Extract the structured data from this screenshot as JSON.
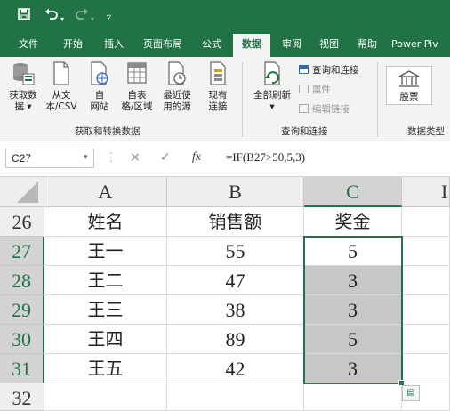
{
  "title_bar": {
    "save_icon": "save-icon",
    "undo_icon": "undo-icon",
    "redo_icon": "redo-icon",
    "customize_icon": "chevron-down-icon"
  },
  "ribbon_tabs": [
    {
      "label": "文件"
    },
    {
      "label": "开始"
    },
    {
      "label": "插入"
    },
    {
      "label": "页面布局"
    },
    {
      "label": "公式"
    },
    {
      "label": "数据"
    },
    {
      "label": "审阅"
    },
    {
      "label": "视图"
    },
    {
      "label": "帮助"
    },
    {
      "label": "Power Piv"
    }
  ],
  "ribbon": {
    "get_transform": {
      "get_data": {
        "line1": "获取数",
        "line2": "据 ▾"
      },
      "from_csv": {
        "line1": "从文",
        "line2": "本/CSV"
      },
      "from_web": {
        "line1": "自",
        "line2": "网站"
      },
      "from_table": {
        "line1": "自表",
        "line2": "格/区域"
      },
      "recent_sources": {
        "line1": "最近使",
        "line2": "用的源"
      },
      "existing": {
        "line1": "现有",
        "line2": "连接"
      },
      "group_label": "获取和转换数据"
    },
    "queries": {
      "refresh_all": {
        "line1": "全部刷新",
        "line2": "▾"
      },
      "queries_connections": "查询和连接",
      "properties": "属性",
      "edit_links": "编辑链接",
      "group_label": "查询和连接"
    },
    "data_types": {
      "stocks": "股票",
      "group_label": "数据类型"
    }
  },
  "formula_bar": {
    "name_box": "C27",
    "cancel_icon": "×",
    "enter_icon": "✓",
    "fx_icon": "fx",
    "formula": "=IF(B27>50,5,3)"
  },
  "sheet": {
    "columns": [
      "A",
      "B",
      "C",
      "I"
    ],
    "rows": [
      {
        "num": "26",
        "a": "姓名",
        "b": "销售额",
        "c": "奖金"
      },
      {
        "num": "27",
        "a": "王一",
        "b": "55",
        "c": "5"
      },
      {
        "num": "28",
        "a": "王二",
        "b": "47",
        "c": "3"
      },
      {
        "num": "29",
        "a": "王三",
        "b": "38",
        "c": "3"
      },
      {
        "num": "30",
        "a": "王四",
        "b": "89",
        "c": "5"
      },
      {
        "num": "31",
        "a": "王五",
        "b": "42",
        "c": "3"
      },
      {
        "num": "32",
        "a": "",
        "b": "",
        "c": ""
      }
    ]
  },
  "colors": {
    "excel_green": "#217346",
    "selection_fill": "#c7c7c7"
  }
}
